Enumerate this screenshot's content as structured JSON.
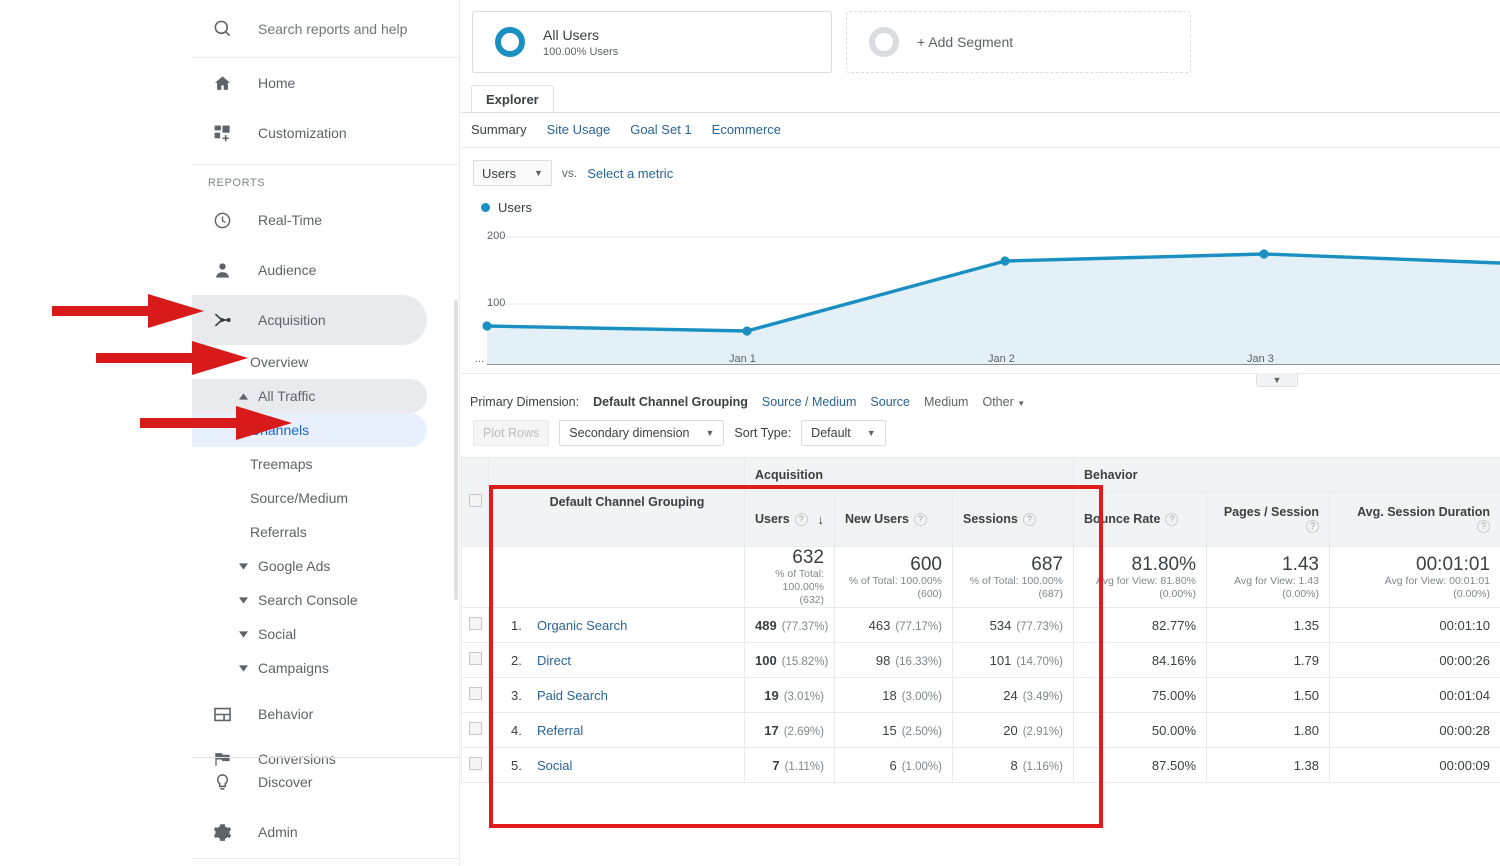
{
  "sidebar": {
    "search": {
      "placeholder": "Search reports and help",
      "icon": "search-icon"
    },
    "top_items": [
      {
        "label": "Home",
        "icon": "home-icon"
      },
      {
        "label": "Customization",
        "icon": "customization-icon"
      }
    ],
    "section_label": "REPORTS",
    "report_items": [
      {
        "label": "Real-Time",
        "icon": "clock-icon"
      },
      {
        "label": "Audience",
        "icon": "person-icon"
      },
      {
        "label": "Acquisition",
        "icon": "acquisition-icon"
      }
    ],
    "acquisition_children": [
      {
        "label": "Overview",
        "type": "leaf"
      },
      {
        "label": "All Traffic",
        "type": "expanded"
      },
      {
        "label": "Channels",
        "type": "leaf-current"
      },
      {
        "label": "Treemaps",
        "type": "leaf"
      },
      {
        "label": "Source/Medium",
        "type": "leaf"
      },
      {
        "label": "Referrals",
        "type": "leaf"
      },
      {
        "label": "Google Ads",
        "type": "collapsed"
      },
      {
        "label": "Search Console",
        "type": "collapsed"
      },
      {
        "label": "Social",
        "type": "collapsed"
      },
      {
        "label": "Campaigns",
        "type": "collapsed"
      }
    ],
    "bottom_items": [
      {
        "label": "Behavior",
        "icon": "behavior-icon"
      },
      {
        "label": "Conversions",
        "icon": "flag-icon"
      },
      {
        "label": "Discover",
        "icon": "lightbulb-icon"
      },
      {
        "label": "Admin",
        "icon": "gear-icon"
      }
    ]
  },
  "segments": {
    "active": {
      "title": "All Users",
      "subtitle": "100.00% Users"
    },
    "add_label": "+ Add Segment"
  },
  "tabs": {
    "explorer": "Explorer",
    "subtabs": [
      {
        "label": "Summary",
        "active": true
      },
      {
        "label": "Site Usage",
        "active": false
      },
      {
        "label": "Goal Set 1",
        "active": false
      },
      {
        "label": "Ecommerce",
        "active": false
      }
    ]
  },
  "metric_controls": {
    "primary_metric": "Users",
    "vs_label": "vs.",
    "select_metric": "Select a metric"
  },
  "chart_data": {
    "type": "line",
    "title": "",
    "legend": [
      "Users"
    ],
    "legend_position": "top-left",
    "series": [
      {
        "name": "Users",
        "values": [
          57,
          52,
          154,
          161,
          148
        ]
      }
    ],
    "x": [
      "...",
      "Jan 1",
      "Jan 2",
      "Jan 3",
      ""
    ],
    "xlabel": "",
    "ylabel": "",
    "ylim": [
      0,
      220
    ],
    "yticks": [
      100,
      200
    ],
    "grid": true,
    "color": "#1a8fc1",
    "fill": "#e3f0f7"
  },
  "primary_dimension": {
    "lead": "Primary Dimension:",
    "selected": "Default Channel Grouping",
    "options": [
      "Source / Medium",
      "Source",
      "Medium",
      "Other"
    ]
  },
  "table_controls": {
    "plot_rows": "Plot Rows",
    "secondary_dimension": "Secondary dimension",
    "sort_type_label": "Sort Type:",
    "sort_type_value": "Default"
  },
  "table": {
    "groups": [
      {
        "label": "Acquisition",
        "span": 3
      },
      {
        "label": "Behavior",
        "span": 3
      }
    ],
    "dimension_header": "Default Channel Grouping",
    "columns": [
      {
        "label": "Users",
        "help": true,
        "sorted": "desc"
      },
      {
        "label": "New Users",
        "help": true,
        "sorted": null
      },
      {
        "label": "Sessions",
        "help": true,
        "sorted": null
      },
      {
        "label": "Bounce Rate",
        "help": true,
        "sorted": null
      },
      {
        "label": "Pages / Session",
        "help": true,
        "sorted": null
      },
      {
        "label": "Avg. Session Duration",
        "help": true,
        "sorted": null
      }
    ],
    "totals": [
      {
        "value": "632",
        "note1": "% of Total: 100.00%",
        "note2": "(632)"
      },
      {
        "value": "600",
        "note1": "% of Total: 100.00%",
        "note2": "(600)"
      },
      {
        "value": "687",
        "note1": "% of Total: 100.00%",
        "note2": "(687)"
      },
      {
        "value": "81.80%",
        "note1": "Avg for View: 81.80%",
        "note2": "(0.00%)"
      },
      {
        "value": "1.43",
        "note1": "Avg for View: 1.43",
        "note2": "(0.00%)"
      },
      {
        "value": "00:01:01",
        "note1": "Avg for View: 00:01:01",
        "note2": "(0.00%)"
      }
    ],
    "rows": [
      {
        "index": "1.",
        "name": "Organic Search",
        "users": "489",
        "users_pct": "(77.37%)",
        "new_users": "463",
        "new_users_pct": "(77.17%)",
        "sessions": "534",
        "sessions_pct": "(77.73%)",
        "bounce_rate": "82.77%",
        "pages_session": "1.35",
        "avg_duration": "00:01:10"
      },
      {
        "index": "2.",
        "name": "Direct",
        "users": "100",
        "users_pct": "(15.82%)",
        "new_users": "98",
        "new_users_pct": "(16.33%)",
        "sessions": "101",
        "sessions_pct": "(14.70%)",
        "bounce_rate": "84.16%",
        "pages_session": "1.79",
        "avg_duration": "00:00:26"
      },
      {
        "index": "3.",
        "name": "Paid Search",
        "users": "19",
        "users_pct": "(3.01%)",
        "new_users": "18",
        "new_users_pct": "(3.00%)",
        "sessions": "24",
        "sessions_pct": "(3.49%)",
        "bounce_rate": "75.00%",
        "pages_session": "1.50",
        "avg_duration": "00:01:04"
      },
      {
        "index": "4.",
        "name": "Referral",
        "users": "17",
        "users_pct": "(2.69%)",
        "new_users": "15",
        "new_users_pct": "(2.50%)",
        "sessions": "20",
        "sessions_pct": "(2.91%)",
        "bounce_rate": "50.00%",
        "pages_session": "1.80",
        "avg_duration": "00:00:28"
      },
      {
        "index": "5.",
        "name": "Social",
        "users": "7",
        "users_pct": "(1.11%)",
        "new_users": "6",
        "new_users_pct": "(1.00%)",
        "sessions": "8",
        "sessions_pct": "(1.16%)",
        "bounce_rate": "87.50%",
        "pages_session": "1.38",
        "avg_duration": "00:00:09"
      }
    ]
  },
  "annotations": {
    "color": "#e01b1b",
    "arrows": [
      "acquisition",
      "all-traffic",
      "channels"
    ],
    "highlight_box": "acquisition-columns"
  }
}
